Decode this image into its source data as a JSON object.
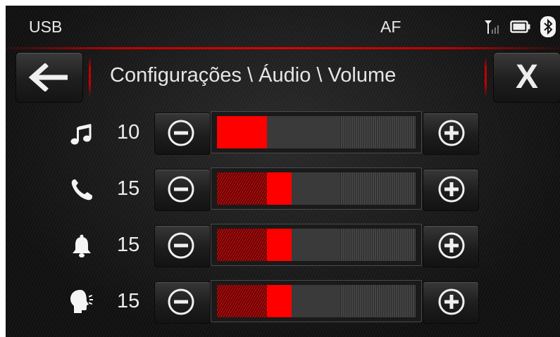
{
  "status_bar": {
    "source": "USB",
    "center": "AF",
    "icons": [
      "signal-icon",
      "battery-icon",
      "bluetooth-icon"
    ]
  },
  "header": {
    "title": "Configurações \\ Áudio \\ Volume",
    "back_icon": "back-arrow-icon",
    "close_label": "X"
  },
  "colors": {
    "accent": "#ff0000",
    "accent_dark": "#c00000",
    "background": "#141414",
    "text": "#e6e6e6"
  },
  "volume_max": 40,
  "rows": [
    {
      "icon": "music-icon",
      "value": "10",
      "level": 10
    },
    {
      "icon": "phone-icon",
      "value": "15",
      "level": 15
    },
    {
      "icon": "bell-icon",
      "value": "15",
      "level": 15
    },
    {
      "icon": "voice-icon",
      "value": "15",
      "level": 15
    }
  ]
}
